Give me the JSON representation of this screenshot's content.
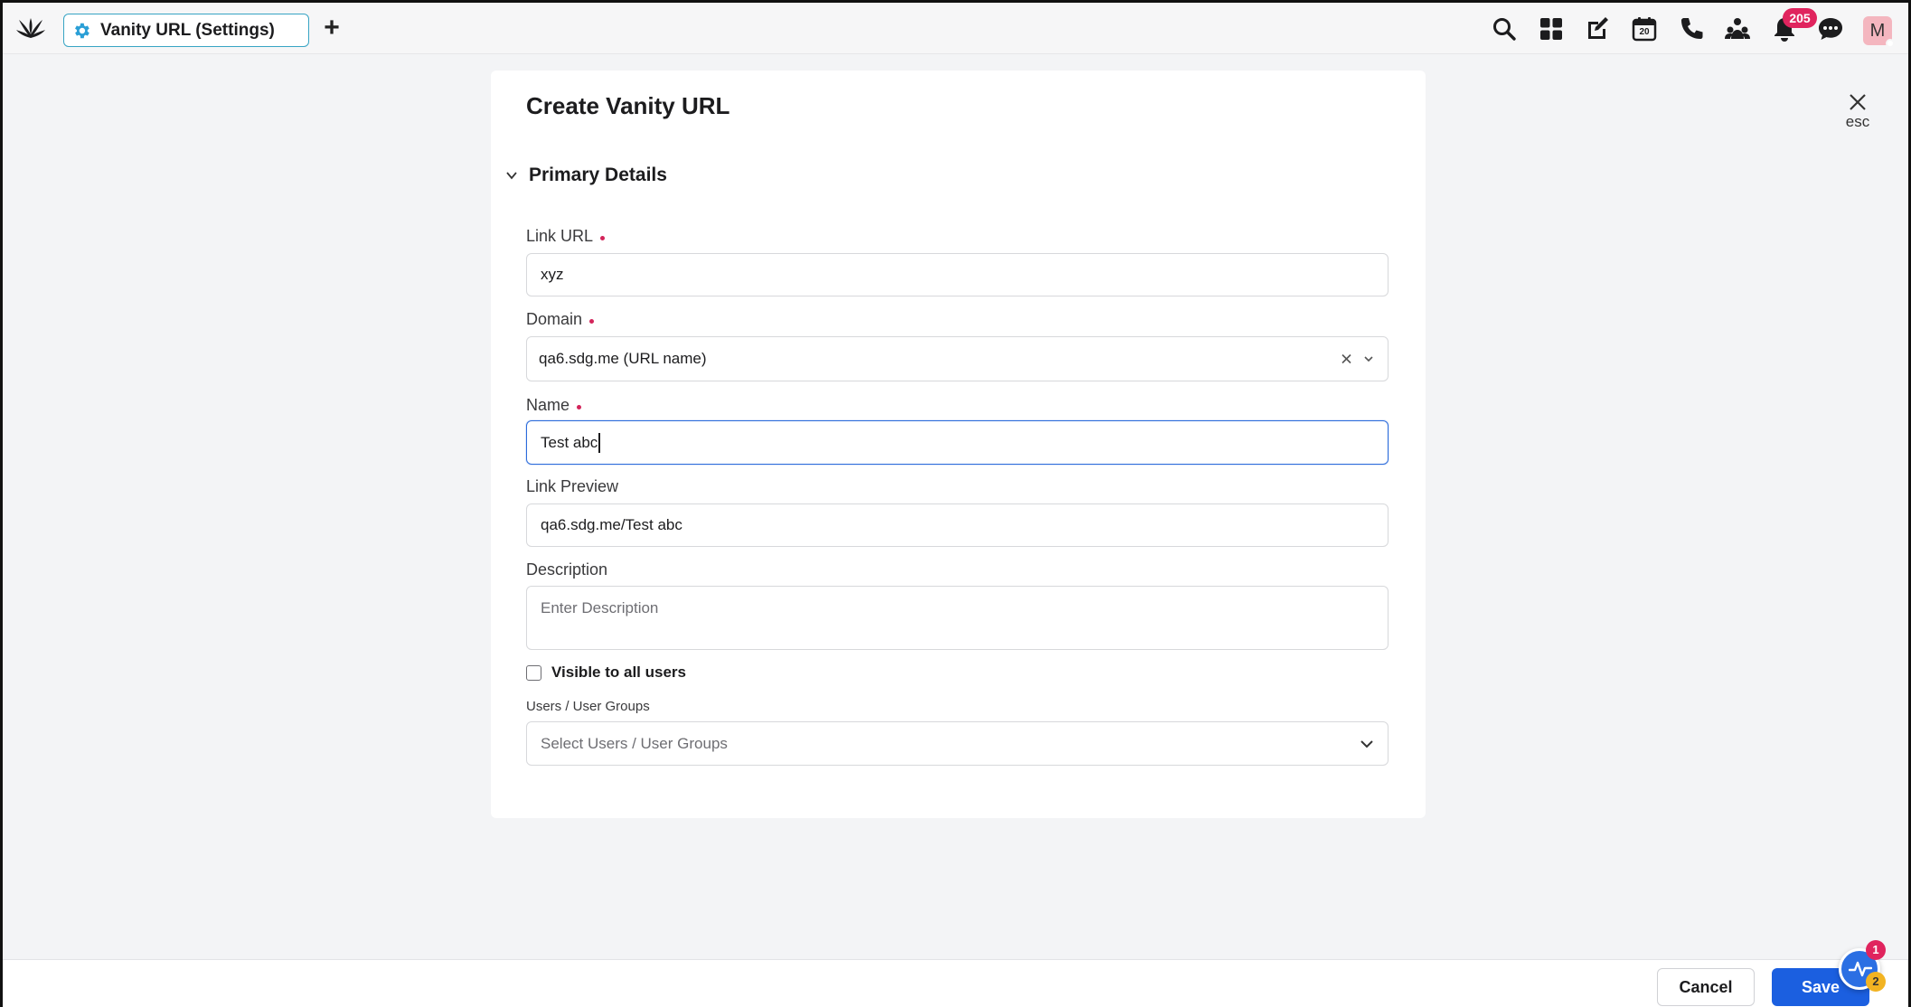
{
  "topbar": {
    "tab_title": "Vanity URL (Settings)",
    "add_tab_symbol": "+",
    "icons": [
      "search-icon",
      "apps-grid-icon",
      "compose-icon",
      "calendar-icon",
      "phone-icon",
      "community-icon",
      "bell-icon",
      "chat-icon"
    ],
    "calendar_day": "20",
    "notification_count": "205",
    "avatar_initial": "M"
  },
  "close": {
    "esc_label": "esc"
  },
  "form": {
    "title": "Create Vanity URL",
    "section_title": "Primary Details",
    "link_url": {
      "label": "Link URL",
      "value": "xyz",
      "required": true
    },
    "domain": {
      "label": "Domain",
      "value": "qa6.sdg.me (URL name)",
      "required": true
    },
    "name": {
      "label": "Name",
      "value": "Test abc",
      "required": true
    },
    "link_preview": {
      "label": "Link Preview",
      "value": "qa6.sdg.me/Test abc"
    },
    "description": {
      "label": "Description",
      "placeholder": "Enter Description"
    },
    "visible_all": {
      "label": "Visible to all users",
      "checked": false
    },
    "user_groups": {
      "label": "Users / User Groups",
      "placeholder": "Select Users / User Groups"
    }
  },
  "footer": {
    "cancel_label": "Cancel",
    "save_label": "Save",
    "fab_badge_1": "1",
    "fab_badge_2": "2"
  },
  "colors": {
    "accent": "#1b5fe0",
    "tab_border": "#37a4c4",
    "required": "#d3245a",
    "badge": "#e0245e"
  }
}
